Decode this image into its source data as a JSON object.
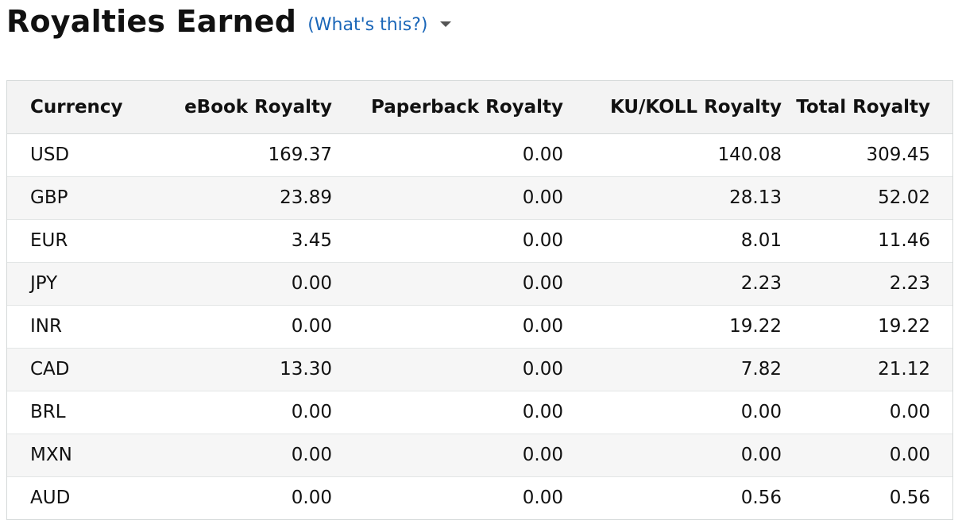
{
  "header": {
    "title": "Royalties Earned",
    "help_link": "(What's this?)",
    "dropdown_icon": "caret-down-icon"
  },
  "table": {
    "columns": [
      "Currency",
      "eBook Royalty",
      "Paperback Royalty",
      "KU/KOLL Royalty",
      "Total Royalty"
    ],
    "rows": [
      {
        "currency": "USD",
        "ebook": "169.37",
        "paperback": "0.00",
        "ku_koll": "140.08",
        "total": "309.45"
      },
      {
        "currency": "GBP",
        "ebook": "23.89",
        "paperback": "0.00",
        "ku_koll": "28.13",
        "total": "52.02"
      },
      {
        "currency": "EUR",
        "ebook": "3.45",
        "paperback": "0.00",
        "ku_koll": "8.01",
        "total": "11.46"
      },
      {
        "currency": "JPY",
        "ebook": "0.00",
        "paperback": "0.00",
        "ku_koll": "2.23",
        "total": "2.23"
      },
      {
        "currency": "INR",
        "ebook": "0.00",
        "paperback": "0.00",
        "ku_koll": "19.22",
        "total": "19.22"
      },
      {
        "currency": "CAD",
        "ebook": "13.30",
        "paperback": "0.00",
        "ku_koll": "7.82",
        "total": "21.12"
      },
      {
        "currency": "BRL",
        "ebook": "0.00",
        "paperback": "0.00",
        "ku_koll": "0.00",
        "total": "0.00"
      },
      {
        "currency": "MXN",
        "ebook": "0.00",
        "paperback": "0.00",
        "ku_koll": "0.00",
        "total": "0.00"
      },
      {
        "currency": "AUD",
        "ebook": "0.00",
        "paperback": "0.00",
        "ku_koll": "0.56",
        "total": "0.56"
      }
    ]
  },
  "colors": {
    "link": "#1a66b8",
    "header_bg": "#f3f3f3",
    "stripe_bg": "#f6f6f6",
    "border": "#d5d9d9"
  }
}
